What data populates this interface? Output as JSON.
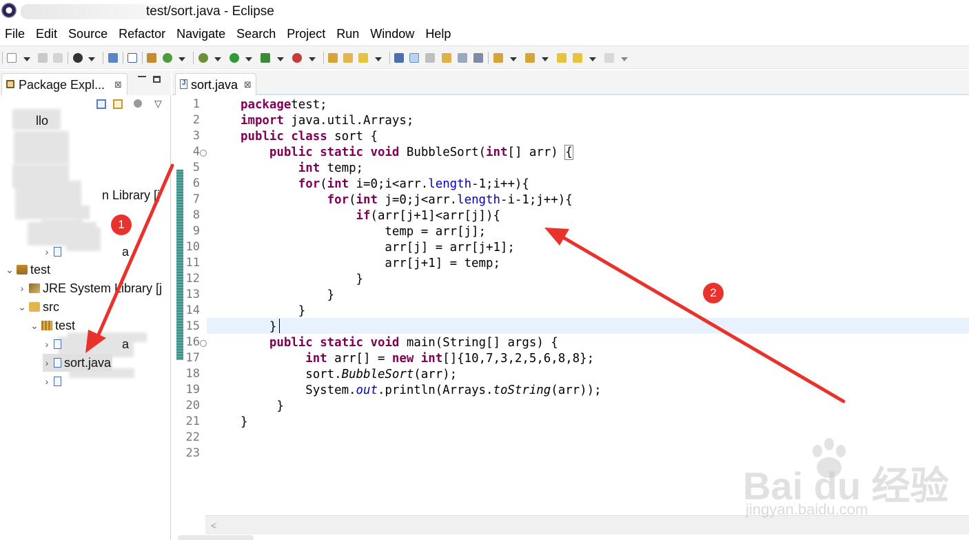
{
  "window": {
    "title": "test/sort.java - Eclipse"
  },
  "menu": [
    "File",
    "Edit",
    "Source",
    "Refactor",
    "Navigate",
    "Search",
    "Project",
    "Run",
    "Window",
    "Help"
  ],
  "package_explorer": {
    "tab_label": "Package Expl...",
    "close_glyph": "⊠",
    "tree": [
      {
        "label": "llo",
        "indent": 0,
        "twisty": "",
        "icon": "blurred-icon"
      },
      {
        "label": "n Library [j",
        "indent": 2,
        "twisty": "",
        "icon": "blurred-icon"
      },
      {
        "label": "a",
        "indent": 3,
        "twisty": "›",
        "icon": "java-file-icon"
      },
      {
        "label": "test",
        "indent": 0,
        "twisty": "⌄",
        "icon": "java-project-icon"
      },
      {
        "label": "JRE System Library [j",
        "indent": 1,
        "twisty": "›",
        "icon": "library-icon"
      },
      {
        "label": "src",
        "indent": 1,
        "twisty": "⌄",
        "icon": "source-folder-icon"
      },
      {
        "label": "test",
        "indent": 2,
        "twisty": "⌄",
        "icon": "package-icon"
      },
      {
        "label": "a",
        "indent": 3,
        "twisty": "›",
        "icon": "java-file-icon"
      },
      {
        "label": "sort.java",
        "indent": 3,
        "twisty": "›",
        "icon": "java-file-icon",
        "selected": true
      },
      {
        "label": "",
        "indent": 3,
        "twisty": "›",
        "icon": "java-file-icon"
      }
    ]
  },
  "editor": {
    "tab_label": "sort.java",
    "close_glyph": "⊠",
    "current_line": 15,
    "lines": [
      [
        [
          "kw",
          "package"
        ],
        [
          "",
          "test;"
        ]
      ],
      [
        [
          "kw",
          "import"
        ],
        [
          "",
          " java.util.Arrays;"
        ]
      ],
      [
        [
          "kw",
          "public"
        ],
        [
          "",
          " "
        ],
        [
          "kw",
          "class"
        ],
        [
          "",
          " sort {"
        ]
      ],
      [
        [
          "",
          "    "
        ],
        [
          "kw",
          "public"
        ],
        [
          "",
          " "
        ],
        [
          "kw",
          "static"
        ],
        [
          "",
          " "
        ],
        [
          "kw",
          "void"
        ],
        [
          "",
          " BubbleSort("
        ],
        [
          "kw",
          "int"
        ],
        [
          "",
          "[] arr) "
        ],
        [
          "box",
          "{"
        ]
      ],
      [
        [
          "",
          "        "
        ],
        [
          "kw",
          "int"
        ],
        [
          "",
          " temp;"
        ]
      ],
      [
        [
          "",
          "        "
        ],
        [
          "kw",
          "for"
        ],
        [
          "",
          "("
        ],
        [
          "kw",
          "int"
        ],
        [
          "",
          " i=0;i<arr."
        ],
        [
          "fld",
          "length"
        ],
        [
          "",
          "-1;i++){"
        ]
      ],
      [
        [
          "",
          "            "
        ],
        [
          "kw",
          "for"
        ],
        [
          "",
          "("
        ],
        [
          "kw",
          "int"
        ],
        [
          "",
          " j=0;j<arr."
        ],
        [
          "fld",
          "length"
        ],
        [
          "",
          "-i-1;j++){"
        ]
      ],
      [
        [
          "",
          "                "
        ],
        [
          "kw",
          "if"
        ],
        [
          "",
          "(arr[j+1]<arr[j]){"
        ]
      ],
      [
        [
          "",
          "                    temp = arr[j];"
        ]
      ],
      [
        [
          "",
          "                    arr[j] = arr[j+1];"
        ]
      ],
      [
        [
          "",
          "                    arr[j+1] = temp;"
        ]
      ],
      [
        [
          "",
          "                }"
        ]
      ],
      [
        [
          "",
          "            }"
        ]
      ],
      [
        [
          "",
          "        }"
        ]
      ],
      [
        [
          "",
          "    }"
        ]
      ],
      [
        [
          "",
          "    "
        ],
        [
          "kw",
          "public"
        ],
        [
          "",
          " "
        ],
        [
          "kw",
          "static"
        ],
        [
          "",
          " "
        ],
        [
          "kw",
          "void"
        ],
        [
          "",
          " main(String[] args) {"
        ]
      ],
      [
        [
          "",
          "         "
        ],
        [
          "kw",
          "int"
        ],
        [
          "",
          " arr[] = "
        ],
        [
          "kw",
          "new"
        ],
        [
          "",
          " "
        ],
        [
          "kw",
          "int"
        ],
        [
          "",
          "[]{10,7,3,2,5,6,8,8};"
        ]
      ],
      [
        [
          "",
          "         sort."
        ],
        [
          "ital",
          "BubbleSort"
        ],
        [
          "",
          "(arr);"
        ]
      ],
      [
        [
          "",
          "         System."
        ],
        [
          "sfld",
          "out"
        ],
        [
          "",
          ".println(Arrays."
        ],
        [
          "ital",
          "toString"
        ],
        [
          "",
          "(arr));"
        ]
      ],
      [
        [
          "",
          "     }"
        ]
      ],
      [
        [
          "",
          "}"
        ]
      ],
      [
        [
          "",
          ""
        ]
      ],
      [
        [
          "",
          ""
        ]
      ]
    ],
    "fold_lines": [
      4,
      16
    ]
  },
  "annotations": {
    "badge_1": "1",
    "badge_2": "2",
    "color": "#e8322b"
  },
  "watermark": {
    "brand": "Bai du 经验",
    "url": "jingyan.baidu.com"
  },
  "colors": {
    "keyword": "#7f0055",
    "field": "#0000c0",
    "current_line": "#e8f2fe",
    "line_number": "#787878"
  }
}
